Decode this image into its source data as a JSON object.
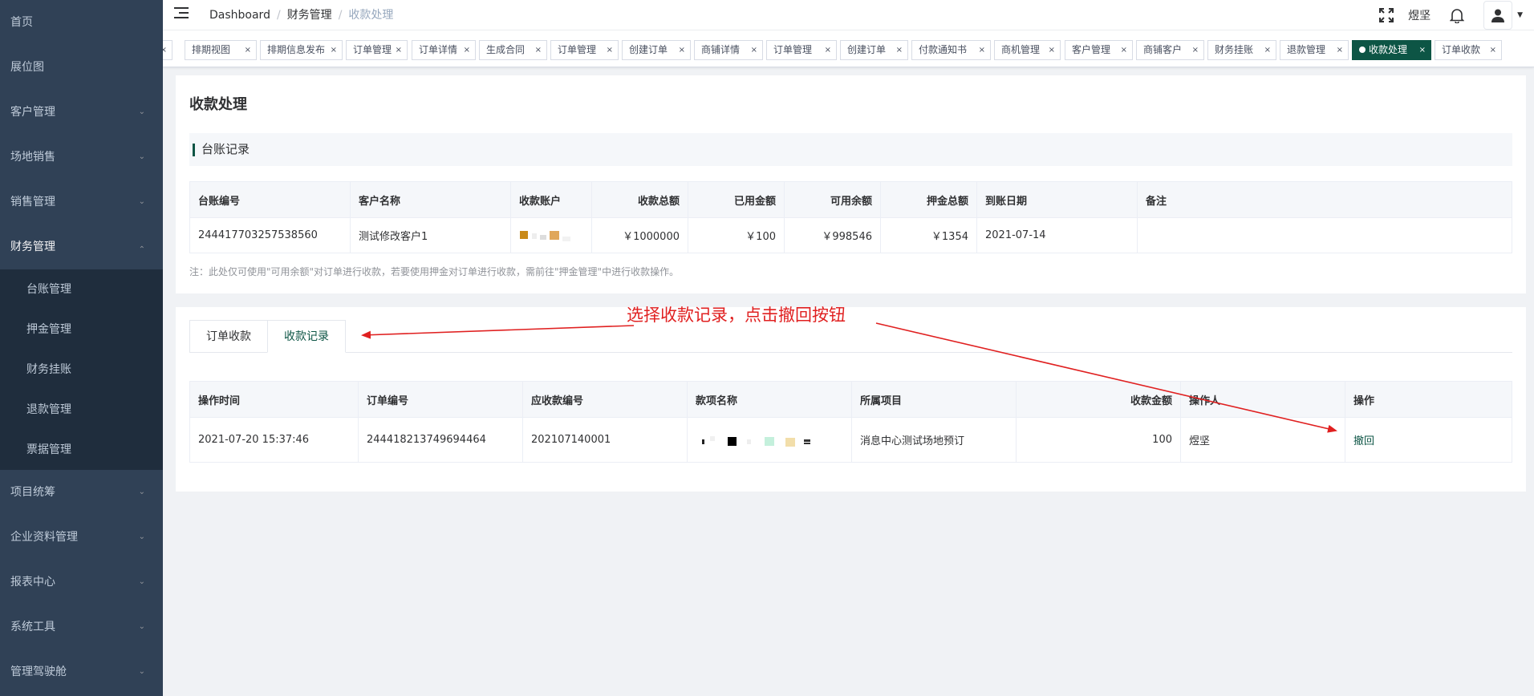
{
  "sidebar": {
    "items": [
      {
        "label": "首页"
      },
      {
        "label": "展位图"
      },
      {
        "label": "客户管理"
      },
      {
        "label": "场地销售"
      },
      {
        "label": "销售管理"
      },
      {
        "label": "财务管理"
      },
      {
        "label": "项目统筹"
      },
      {
        "label": "企业资料管理"
      },
      {
        "label": "报表中心"
      },
      {
        "label": "系统工具"
      },
      {
        "label": "管理驾驶舱"
      }
    ],
    "finance_sub": [
      {
        "label": "台账管理"
      },
      {
        "label": "押金管理"
      },
      {
        "label": "财务挂账"
      },
      {
        "label": "退款管理"
      },
      {
        "label": "票据管理"
      }
    ]
  },
  "navbar": {
    "breadcrumb": [
      "Dashboard",
      "财务管理",
      "收款处理"
    ],
    "username": "煜坚"
  },
  "tags": [
    {
      "label": "排期视图"
    },
    {
      "label": "排期信息发布"
    },
    {
      "label": "订单管理"
    },
    {
      "label": "订单详情"
    },
    {
      "label": "生成合同"
    },
    {
      "label": "订单管理"
    },
    {
      "label": "创建订单"
    },
    {
      "label": "商铺详情"
    },
    {
      "label": "订单管理"
    },
    {
      "label": "创建订单"
    },
    {
      "label": "付款通知书"
    },
    {
      "label": "商机管理"
    },
    {
      "label": "客户管理"
    },
    {
      "label": "商铺客户"
    },
    {
      "label": "财务挂账"
    },
    {
      "label": "退款管理"
    },
    {
      "label": "收款处理",
      "active": true
    },
    {
      "label": "订单收款"
    }
  ],
  "page": {
    "title": "收款处理",
    "section": "台账记录",
    "ledger_headers": [
      "台账编号",
      "客户名称",
      "收款账户",
      "收款总额",
      "已用金额",
      "可用余额",
      "押金总额",
      "到账日期",
      "备注"
    ],
    "ledger_row": {
      "id": "244417703257538560",
      "customer": "测试修改客户1",
      "total": "￥1000000",
      "used": "￥100",
      "available": "￥998546",
      "deposit": "￥1354",
      "date": "2021-07-14",
      "remark": ""
    },
    "note": "注：此处仅可使用\"可用余额\"对订单进行收款，若要使用押金对订单进行收款，需前往\"押金管理\"中进行收款操作。",
    "tabs": [
      "订单收款",
      "收款记录"
    ],
    "record_headers": [
      "操作时间",
      "订单编号",
      "应收款编号",
      "款项名称",
      "所属项目",
      "收款金额",
      "操作人",
      "操作"
    ],
    "record_row": {
      "time": "2021-07-20 15:37:46",
      "order_no": "244418213749694464",
      "receivable_no": "202107140001",
      "project": "消息中心测试场地预订",
      "amount": "100",
      "operator": "煜坚",
      "action": "撤回"
    },
    "annotation": "选择收款记录，点击撤回按钮"
  },
  "colors": {
    "accent": "#0d5545",
    "sidebar": "#304156",
    "annotation": "#e02020"
  }
}
